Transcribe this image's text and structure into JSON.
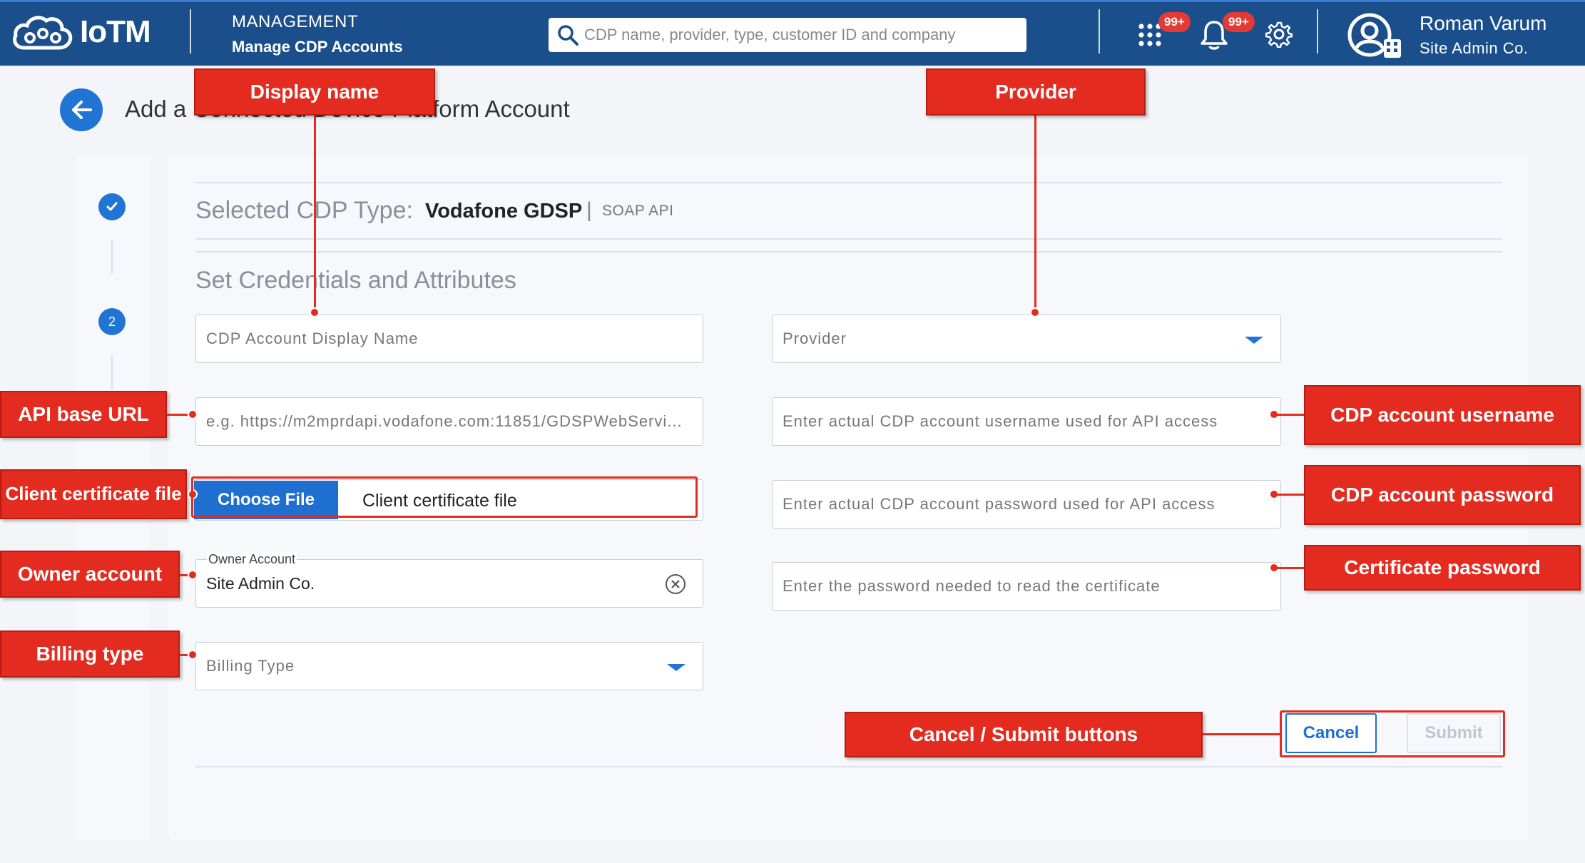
{
  "header": {
    "app_name": "IoTM",
    "section": "MANAGEMENT",
    "subsection": "Manage CDP Accounts",
    "search_placeholder": "CDP name, provider, type, customer ID and company",
    "apps_badge": "99+",
    "notifications_badge": "99+",
    "user_name": "Roman Varum",
    "user_company": "Site Admin Co."
  },
  "page": {
    "title": "Add a Connected Device Platform Account",
    "steps": [
      "2"
    ]
  },
  "form": {
    "selected_type_label": "Selected CDP Type:",
    "selected_type_value": "Vodafone GDSP",
    "selected_type_separator": "|",
    "selected_type_api": "SOAP API",
    "section_title": "Set Credentials and Attributes",
    "display_name_placeholder": "CDP Account Display Name",
    "api_url_placeholder": "e.g. https://m2mprdapi.vodafone.com:11851/GDSPWebServi...",
    "choose_file_label": "Choose File",
    "cert_file_label": "Client certificate file",
    "owner_label": "Owner Account",
    "owner_value": "Site Admin Co.",
    "billing_placeholder": "Billing Type",
    "provider_placeholder": "Provider",
    "username_placeholder": "Enter actual CDP account username used for API access",
    "password_placeholder": "Enter actual CDP account password used for API access",
    "cert_password_placeholder": "Enter the password needed to read the certificate",
    "cancel_label": "Cancel",
    "submit_label": "Submit"
  },
  "annotations": {
    "display_name": "Display name",
    "provider": "Provider",
    "api_base_url": "API base URL",
    "client_cert": "Client certificate file",
    "owner_account": "Owner account",
    "billing_type": "Billing type",
    "cdp_username": "CDP account username",
    "cdp_password": "CDP account password",
    "cert_password": "Certificate password",
    "buttons": "Cancel / Submit buttons",
    "color": "#e42b1f"
  }
}
